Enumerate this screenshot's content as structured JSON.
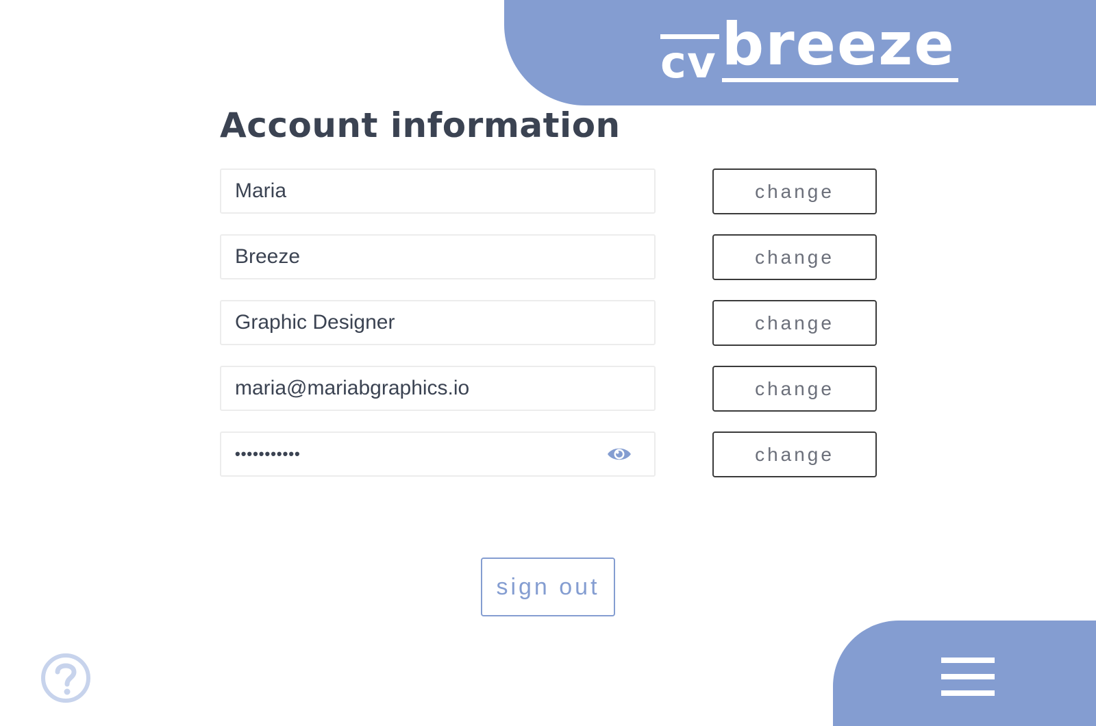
{
  "brand": {
    "logo_cv": "cv",
    "logo_breeze": "breeze",
    "panel_color": "#849dd1"
  },
  "page": {
    "title": "Account information"
  },
  "fields": [
    {
      "name": "first-name",
      "value": "Maria",
      "change_label": "change"
    },
    {
      "name": "last-name",
      "value": "Breeze",
      "change_label": "change"
    },
    {
      "name": "job-title",
      "value": "Graphic Designer",
      "change_label": "change"
    },
    {
      "name": "email",
      "value": "maria@mariabgraphics.io",
      "change_label": "change"
    },
    {
      "name": "password",
      "value": "•••••••••••",
      "change_label": "change",
      "icon": "eye-icon"
    }
  ],
  "actions": {
    "sign_out_label": "sign out"
  },
  "icons": {
    "help": "help-icon",
    "menu": "hamburger-menu-icon"
  },
  "colors": {
    "accent": "#849dd1",
    "text": "#3b4352",
    "button_border": "#3a3a3a",
    "help_icon": "#c7d3ec"
  }
}
